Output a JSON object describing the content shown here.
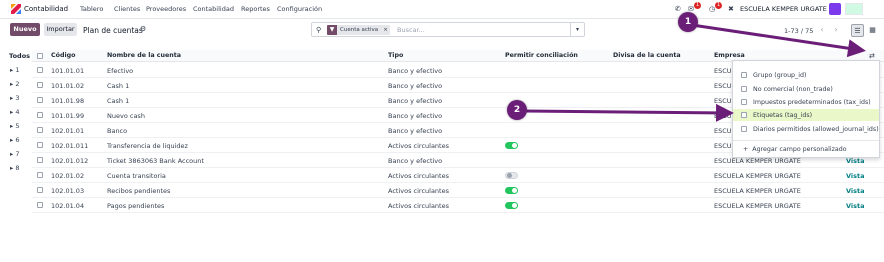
{
  "topbar": {
    "app_name": "Contabilidad",
    "menu": [
      "Tablero",
      "Clientes",
      "Proveedores",
      "Contabilidad",
      "Reportes",
      "Configuración"
    ],
    "chat_badge": "1",
    "activity_badge": "1",
    "company": "ESCUELA KEMPER URGATE"
  },
  "control": {
    "new_label": "Nuevo",
    "import_label": "Importar",
    "breadcrumb": "Plan de cuentas",
    "search_facet": "Cuenta activa",
    "search_facet_close": "×",
    "search_placeholder": "Buscar...",
    "pager": "1-73 / 75"
  },
  "sidebar": {
    "all_label": "Todos",
    "groups": [
      "1",
      "2",
      "3",
      "4",
      "5",
      "6",
      "7",
      "8"
    ]
  },
  "table": {
    "headers": {
      "code": "Código",
      "name": "Nombre de la cuenta",
      "type": "Tipo",
      "reconcile": "Permitir conciliación",
      "currency": "Divisa de la cuenta",
      "company": "Empresa"
    },
    "rows": [
      {
        "code": "101.01.01",
        "name": "Efectivo",
        "type": "Banco y efectivo",
        "toggle": "none",
        "company": "ESCUELA KEMPER",
        "vista": ""
      },
      {
        "code": "101.01.02",
        "name": "Cash 1",
        "type": "Banco y efectivo",
        "toggle": "none",
        "company": "ESCUELA KEMPER",
        "vista": ""
      },
      {
        "code": "101.01.98",
        "name": "Cash 1",
        "type": "Banco y efectivo",
        "toggle": "none",
        "company": "ESCUELA KEMPER",
        "vista": ""
      },
      {
        "code": "101.01.99",
        "name": "Nuevo cash",
        "type": "Banco y efectivo",
        "toggle": "none",
        "company": "ESCUELA KEMPER",
        "vista": ""
      },
      {
        "code": "102.01.01",
        "name": "Banco",
        "type": "Banco y efectivo",
        "toggle": "none",
        "company": "ESCUELA KEMPER",
        "vista": ""
      },
      {
        "code": "102.01.011",
        "name": "Transferencia de liquidez",
        "type": "Activos circulantes",
        "toggle": "on",
        "company": "ESCUELA KEMPER URGATE",
        "vista": "Vista"
      },
      {
        "code": "102.01.012",
        "name": "Ticket 3863063 Bank Account",
        "type": "Banco y efectivo",
        "toggle": "none",
        "company": "ESCUELA KEMPER URGATE",
        "vista": "Vista"
      },
      {
        "code": "102.01.02",
        "name": "Cuenta transitoria",
        "type": "Activos circulantes",
        "toggle": "off",
        "company": "ESCUELA KEMPER URGATE",
        "vista": "Vista"
      },
      {
        "code": "102.01.03",
        "name": "Recibos pendientes",
        "type": "Activos circulantes",
        "toggle": "on",
        "company": "ESCUELA KEMPER URGATE",
        "vista": "Vista"
      },
      {
        "code": "102.01.04",
        "name": "Pagos pendientes",
        "type": "Activos circulantes",
        "toggle": "on",
        "company": "ESCUELA KEMPER URGATE",
        "vista": "Vista"
      }
    ]
  },
  "optional_columns": {
    "items": [
      {
        "label": "Grupo (group_id)",
        "highlighted": false
      },
      {
        "label": "No comercial (non_trade)",
        "highlighted": false
      },
      {
        "label": "Impuestos predeterminados (tax_ids)",
        "highlighted": false
      },
      {
        "label": "Etiquetas (tag_ids)",
        "highlighted": true
      },
      {
        "label": "Diarios permitidos (allowed_journal_ids)",
        "highlighted": false
      }
    ],
    "add_field_label": "Agregar campo personalizado"
  },
  "annotations": {
    "marker_1": "1",
    "marker_2": "2"
  },
  "colors": {
    "brand": "#714b67",
    "annotation": "#6b1e78",
    "link": "#017e84",
    "toggle_on": "#22c55e",
    "highlight": "#eaf7c8"
  }
}
